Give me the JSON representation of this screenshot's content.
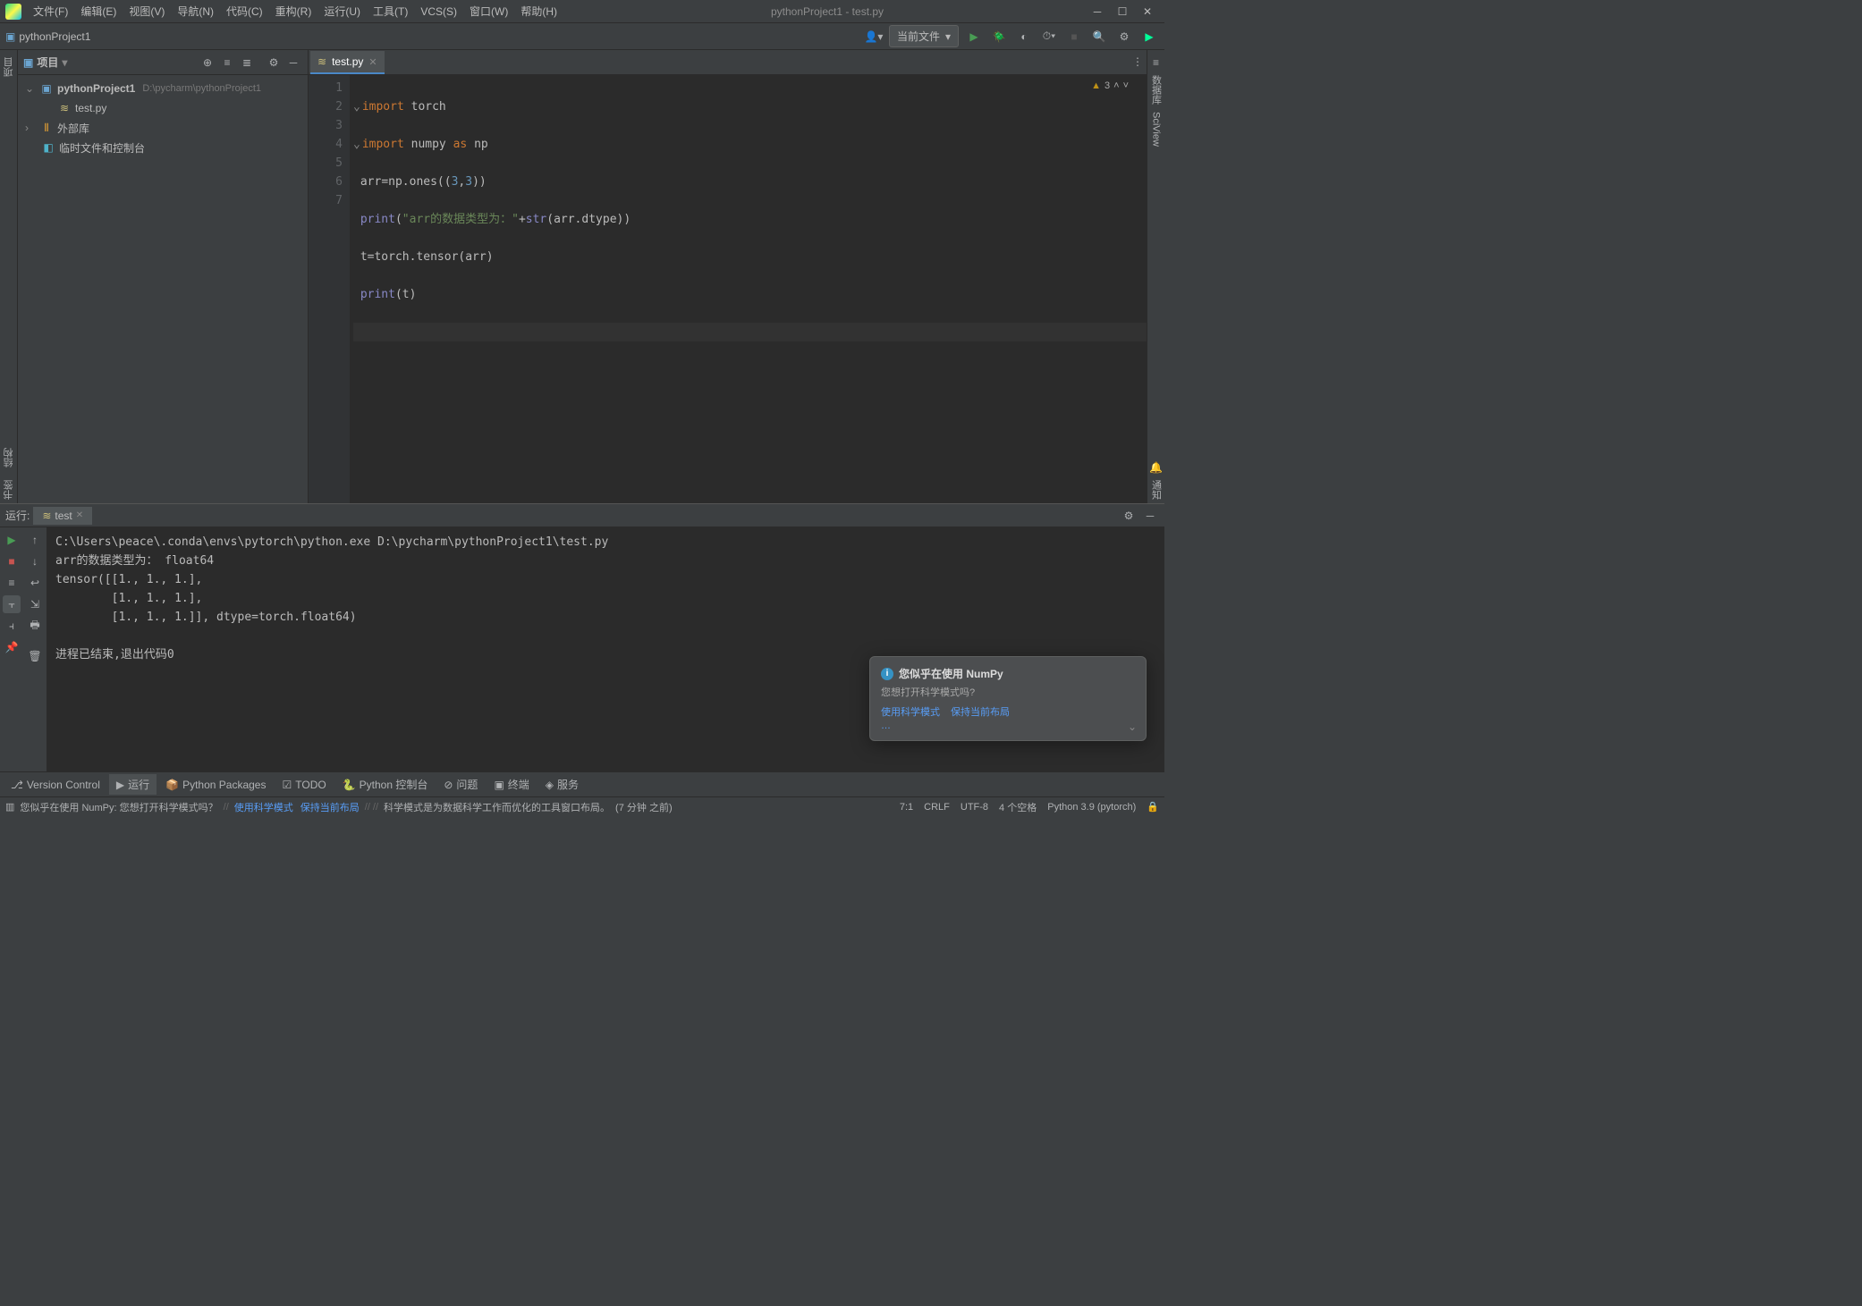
{
  "window": {
    "title": "pythonProject1 - test.py"
  },
  "menu": [
    "文件(F)",
    "编辑(E)",
    "视图(V)",
    "导航(N)",
    "代码(C)",
    "重构(R)",
    "运行(U)",
    "工具(T)",
    "VCS(S)",
    "窗口(W)",
    "帮助(H)"
  ],
  "navbar": {
    "crumb": "pythonProject1",
    "run_config": "当前文件"
  },
  "left_stripe": {
    "project": "项目",
    "structure": "结构"
  },
  "sidebar": {
    "title": "项目",
    "tree": {
      "root_name": "pythonProject1",
      "root_path": "D:\\pycharm\\pythonProject1",
      "file": "test.py",
      "external": "外部库",
      "scratch": "临时文件和控制台"
    }
  },
  "tabs": [
    {
      "name": "test.py"
    }
  ],
  "editor": {
    "lines": [
      "1",
      "2",
      "3",
      "4",
      "5",
      "6",
      "7"
    ],
    "problems_count": "3"
  },
  "code_tokens": {
    "l1": {
      "kw": "import",
      "id": " torch"
    },
    "l2": {
      "kw1": "import",
      "id": " numpy ",
      "kw2": "as",
      "id2": " np"
    },
    "l3": {
      "a": "arr",
      "eq": "=",
      "b": "np.ones((",
      "n1": "3",
      "c": ",",
      "n2": "3",
      "d": "))"
    },
    "l4": {
      "fn": "print",
      "p": "(",
      "s1": "\"arr的数据类型为：\"",
      "plus": "+",
      "str": "str",
      "p2": "(arr.dtype))"
    },
    "l5": {
      "a": "t",
      "eq": "=",
      "b": "torch.tensor(arr)"
    },
    "l6": {
      "fn": "print",
      "p": "(t)"
    }
  },
  "right_stripe": {
    "notifications": "通知",
    "database": "数据库",
    "sciview": "SciView"
  },
  "run": {
    "label": "运行:",
    "tab_name": "test",
    "output": "C:\\Users\\peace\\.conda\\envs\\pytorch\\python.exe D:\\pycharm\\pythonProject1\\test.py\narr的数据类型为： float64\ntensor([[1., 1., 1.],\n        [1., 1., 1.],\n        [1., 1., 1.]], dtype=torch.float64)\n\n进程已结束,退出代码0"
  },
  "bottom_bar": {
    "version_control": "Version Control",
    "run": "运行",
    "python_packages": "Python Packages",
    "todo": "TODO",
    "python_console": "Python 控制台",
    "problems": "问题",
    "terminal": "终端",
    "services": "服务"
  },
  "status": {
    "left_msg": "您似乎在使用 NumPy: 您想打开科学模式吗？",
    "link1": "使用科学模式",
    "link2": "保持当前布局",
    "sep1": " // ",
    "mid": " // // ",
    "desc": "科学模式是为数据科学工作而优化的工具窗口布局。",
    "time": "(7 分钟 之前)",
    "pos": "7:1",
    "crlf": "CRLF",
    "encoding": "UTF-8",
    "indent": "4 个空格",
    "interpreter": "Python 3.9 (pytorch)"
  },
  "popup": {
    "title": "您似乎在使用 NumPy",
    "body": "您想打开科学模式吗?",
    "link1": "使用科学模式",
    "link2": "保持当前布局",
    "more": "…"
  }
}
